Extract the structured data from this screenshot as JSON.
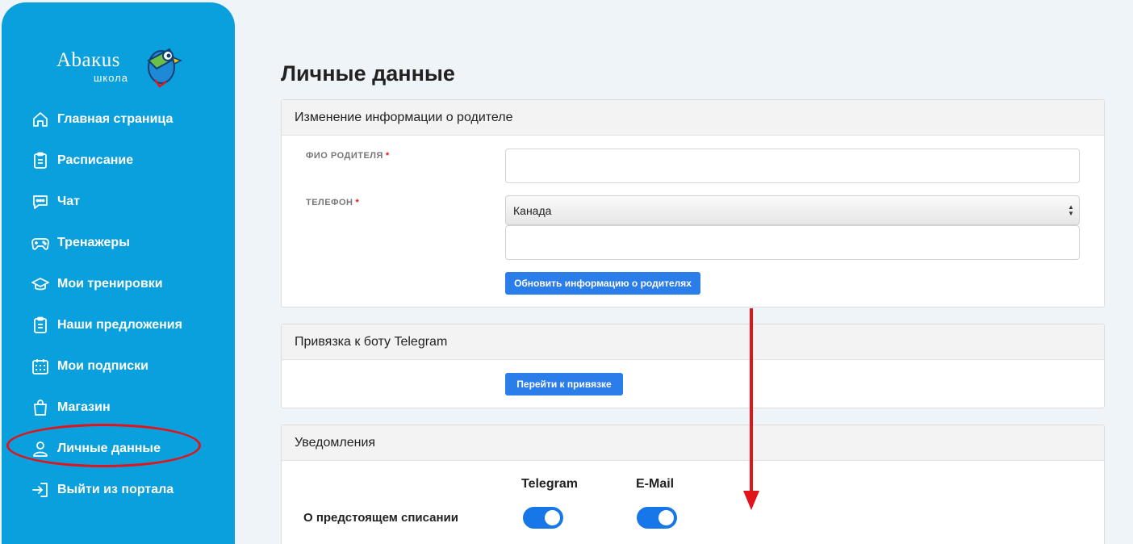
{
  "brand": {
    "name": "Abaкus",
    "subtitle": "школа"
  },
  "nav": {
    "items": [
      {
        "label": "Главная страница",
        "icon": "home-icon"
      },
      {
        "label": "Расписание",
        "icon": "clipboard-icon"
      },
      {
        "label": "Чат",
        "icon": "chat-icon"
      },
      {
        "label": "Тренажеры",
        "icon": "gamepad-icon"
      },
      {
        "label": "Мои тренировки",
        "icon": "graduation-cap-icon"
      },
      {
        "label": "Наши предложения",
        "icon": "clipboard-icon"
      },
      {
        "label": "Мои подписки",
        "icon": "calendar-icon"
      },
      {
        "label": "Магазин",
        "icon": "shopping-bag-icon"
      },
      {
        "label": "Личные данные",
        "icon": "user-icon"
      },
      {
        "label": "Выйти из портала",
        "icon": "logout-icon"
      }
    ],
    "active_index": 8
  },
  "page_title": "Личные данные",
  "parent_card": {
    "header": "Изменение информации о родителе",
    "name_label": "ФИО РОДИТЕЛЯ",
    "name_value": "",
    "phone_label": "ТЕЛЕФОН",
    "required_mark": "*",
    "country_selected": "Канада",
    "phone_value": "",
    "update_button": "Обновить информацию о родителях"
  },
  "telegram_card": {
    "header": "Привязка к боту Telegram",
    "link_button": "Перейти к привязке"
  },
  "notifications_card": {
    "header": "Уведомления",
    "columns": [
      "Telegram",
      "E-Mail"
    ],
    "rows": [
      {
        "label": "О предстоящем списании",
        "telegram": true,
        "email": true
      }
    ]
  },
  "colors": {
    "sidebar": "#0aa0dd",
    "button": "#2b7de9",
    "toggle_on": "#1877e8",
    "annotation": "#e0141b"
  }
}
